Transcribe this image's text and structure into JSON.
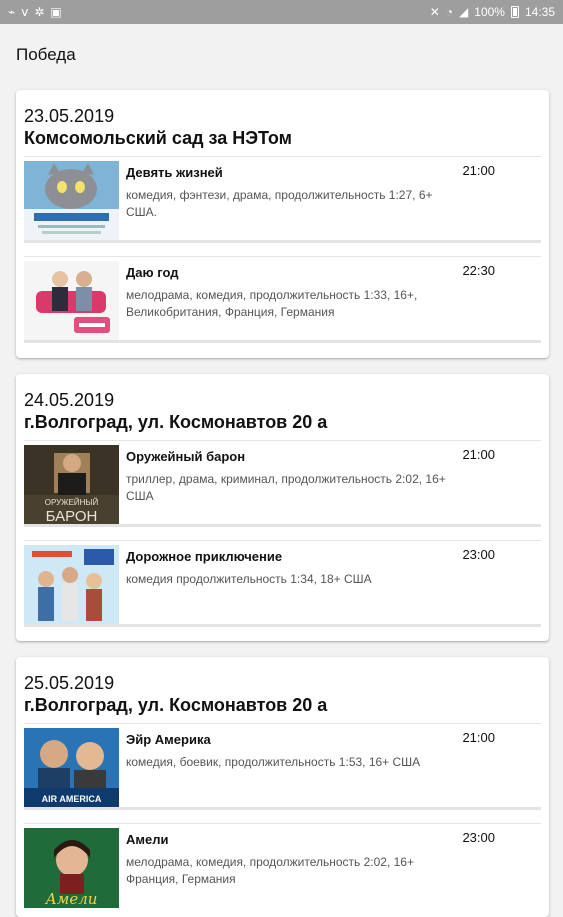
{
  "status_bar": {
    "left_icons": [
      "usb-icon",
      "signal-icon",
      "settings-icon",
      "image-icon"
    ],
    "battery": "100%",
    "time": "14:35"
  },
  "app_bar": {
    "title": "Победа"
  },
  "cards": [
    {
      "date": "23.05.2019",
      "venue": "Комсомольский сад за НЭТом",
      "movies": [
        {
          "title": "Девять жизней",
          "time": "21:00",
          "desc": "комедия, фэнтези, драма, продолжительность 1:27, 6+ США.",
          "poster_icon": "cat-poster-image"
        },
        {
          "title": "Даю год",
          "time": "22:30",
          "desc": "мелодрама, комедия, продолжительность 1:33, 16+, Великобритания, Франция, Германия",
          "poster_icon": "couple-poster-image"
        }
      ]
    },
    {
      "date": "24.05.2019",
      "venue": "г.Волгоград, ул. Космонавтов 20 а",
      "movies": [
        {
          "title": "Оружейный барон",
          "time": "21:00",
          "desc": " триллер, драма, криминал, продолжительность 2:02, 16+ США",
          "poster_icon": "man-poster-image",
          "poster_text": [
            "ОРУЖЕЙНЫЙ",
            "БАРОН"
          ]
        },
        {
          "title": "Дорожное приключение",
          "time": "23:00",
          "desc": "комедия продолжительность 1:34, 18+ США",
          "poster_icon": "group-poster-image"
        }
      ]
    },
    {
      "date": "25.05.2019",
      "venue": "г.Волгоград, ул. Космонавтов 20 а",
      "movies": [
        {
          "title": "Эйр Америка",
          "time": "21:00",
          "desc": " комедия, боевик, продолжительность 1:53, 16+ США",
          "poster_icon": "two-men-poster-image",
          "poster_text": [
            "AIR AMERICA"
          ]
        },
        {
          "title": "Амели",
          "time": "23:00",
          "desc": " мелодрама, комедия, продолжительность 2:02, 16+ Франция, Германия",
          "poster_icon": "woman-poster-image",
          "poster_text": [
            "Амели"
          ]
        }
      ]
    }
  ],
  "colors": {
    "status_bar": "#9e9e9e",
    "background": "#f2f2f2",
    "card": "#ffffff",
    "separator": "#e3e3e3"
  }
}
